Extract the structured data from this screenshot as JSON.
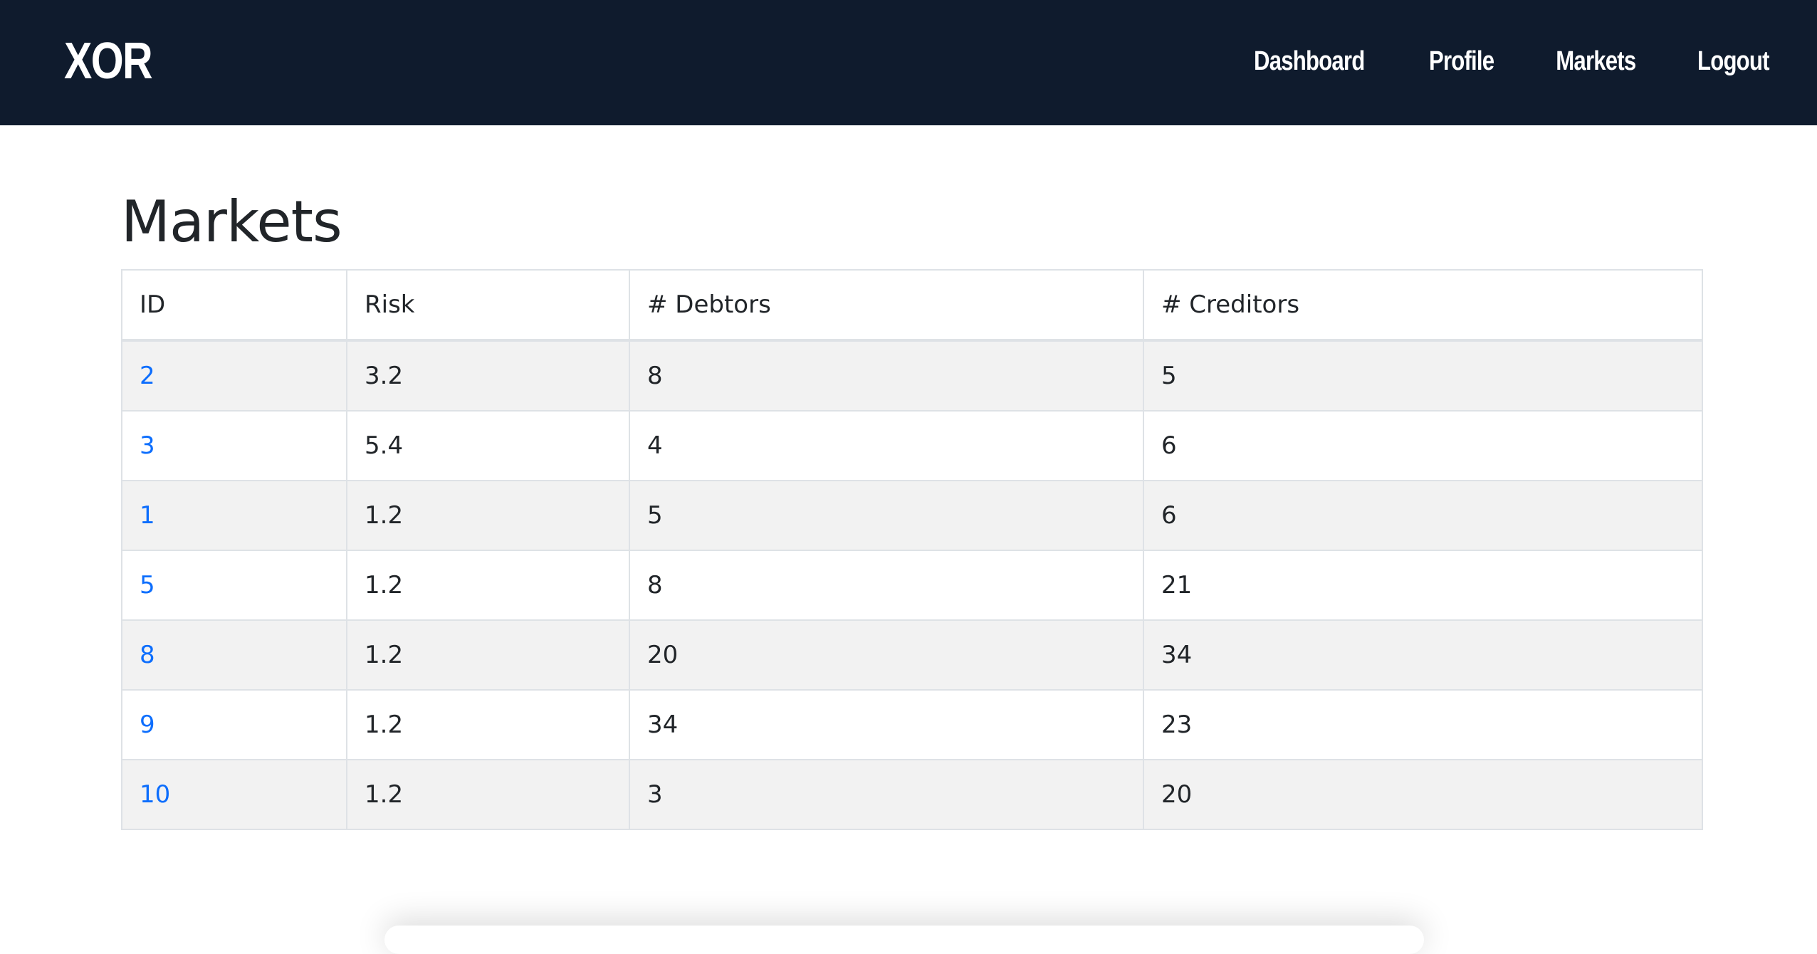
{
  "navbar": {
    "brand": "XOR",
    "links": [
      "Dashboard",
      "Profile",
      "Markets",
      "Logout"
    ]
  },
  "page": {
    "title": "Markets"
  },
  "table": {
    "headers": [
      "ID",
      "Risk",
      "# Debtors",
      "# Creditors"
    ],
    "rows": [
      [
        "2",
        "3.2",
        "8",
        "5"
      ],
      [
        "3",
        "5.4",
        "4",
        "6"
      ],
      [
        "1",
        "1.2",
        "5",
        "6"
      ],
      [
        "5",
        "1.2",
        "8",
        "21"
      ],
      [
        "8",
        "1.2",
        "20",
        "34"
      ],
      [
        "9",
        "1.2",
        "34",
        "23"
      ],
      [
        "10",
        "1.2",
        "3",
        "20"
      ]
    ]
  },
  "colors": {
    "navbar_bg": "#0f1b2d",
    "link": "#0d6efd",
    "stripe": "#f2f2f2"
  }
}
